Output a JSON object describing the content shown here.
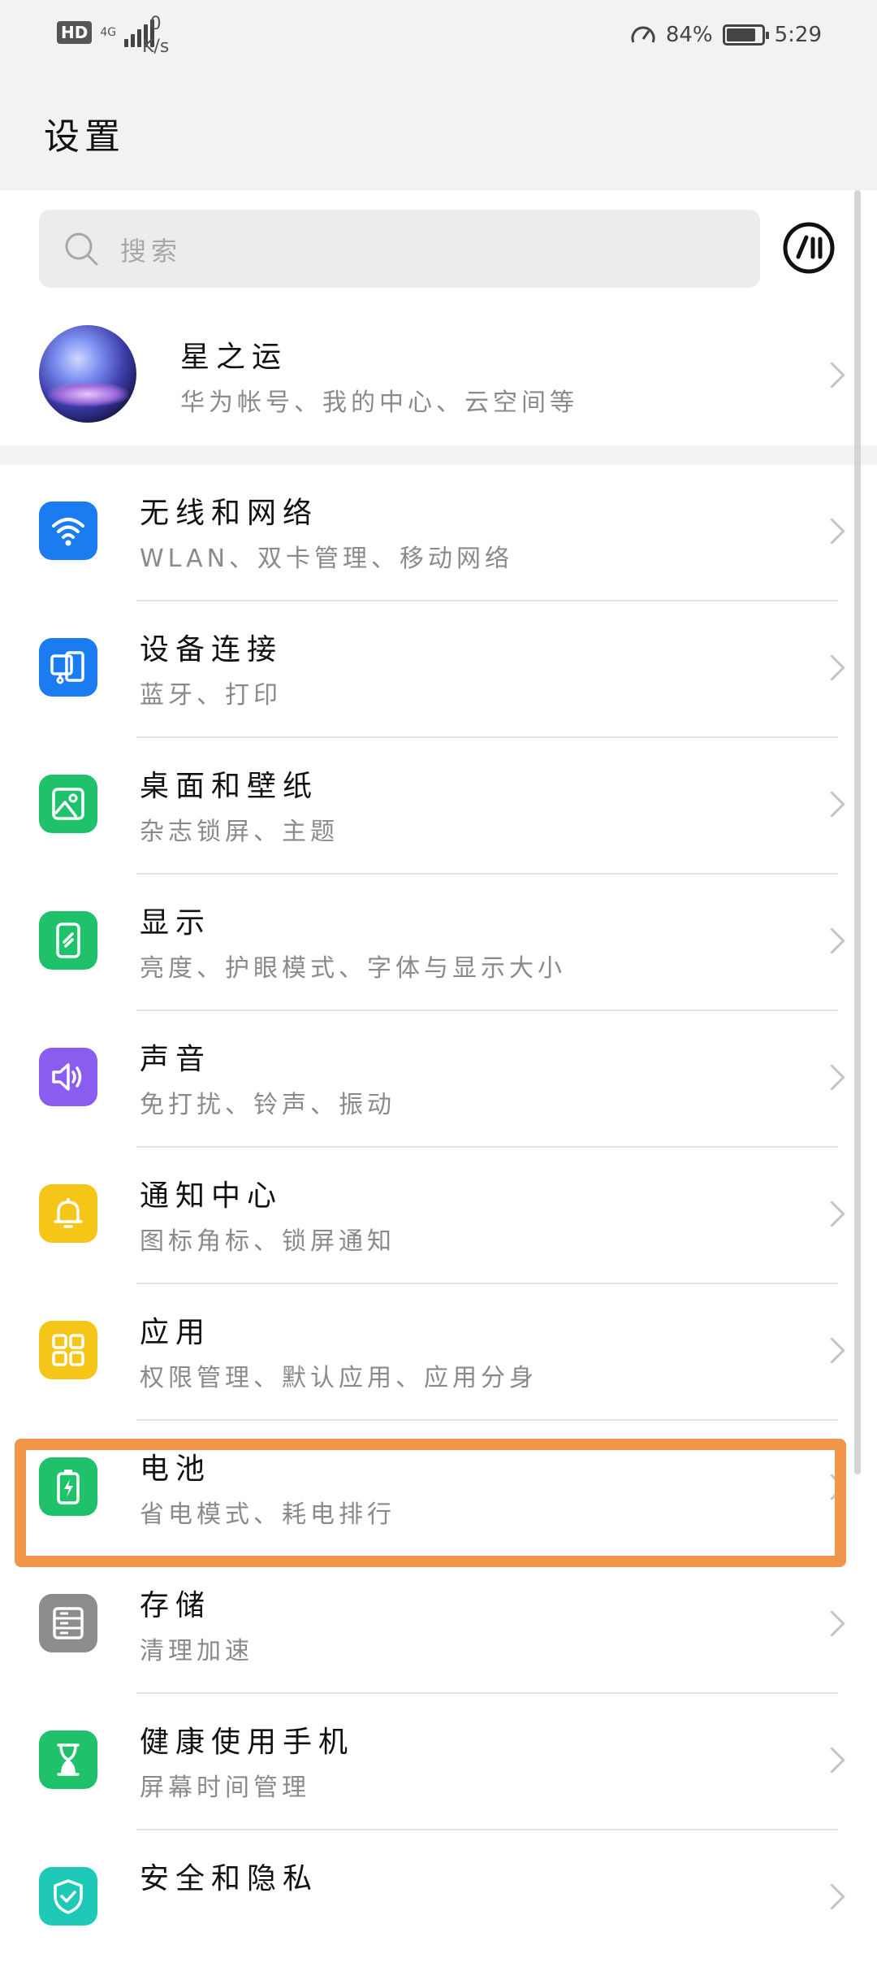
{
  "status_bar": {
    "hd": "HD",
    "network": "4G",
    "speed_value": "0",
    "speed_unit": "K/s",
    "battery_percent": "84%",
    "battery_level": 0.84,
    "time": "5:29"
  },
  "header": {
    "title": "设置"
  },
  "search": {
    "placeholder": "搜索"
  },
  "account": {
    "name": "星之运",
    "subtitle": "华为帐号、我的中心、云空间等"
  },
  "settings": [
    {
      "title": "无线和网络",
      "subtitle": "WLAN、双卡管理、移动网络",
      "icon": "wifi-icon",
      "color": "#1a7cf0"
    },
    {
      "title": "设备连接",
      "subtitle": "蓝牙、打印",
      "icon": "device-connection-icon",
      "color": "#1a7cf0"
    },
    {
      "title": "桌面和壁纸",
      "subtitle": "杂志锁屏、主题",
      "icon": "wallpaper-icon",
      "color": "#1fc26b"
    },
    {
      "title": "显示",
      "subtitle": "亮度、护眼模式、字体与显示大小",
      "icon": "display-icon",
      "color": "#1fc26b"
    },
    {
      "title": "声音",
      "subtitle": "免打扰、铃声、振动",
      "icon": "sound-icon",
      "color": "#8a5cf0"
    },
    {
      "title": "通知中心",
      "subtitle": "图标角标、锁屏通知",
      "icon": "bell-icon",
      "color": "#f5c518"
    },
    {
      "title": "应用",
      "subtitle": "权限管理、默认应用、应用分身",
      "icon": "apps-icon",
      "color": "#f5c518"
    },
    {
      "title": "电池",
      "subtitle": "省电模式、耗电排行",
      "icon": "battery-icon",
      "color": "#1fc26b"
    },
    {
      "title": "存储",
      "subtitle": "清理加速",
      "icon": "storage-icon",
      "color": "#8c8c8c"
    },
    {
      "title": "健康使用手机",
      "subtitle": "屏幕时间管理",
      "icon": "hourglass-icon",
      "color": "#1fc26b"
    },
    {
      "title": "安全和隐私",
      "subtitle": "",
      "icon": "shield-icon",
      "color": "#1ec9b8"
    }
  ],
  "highlight": {
    "color": "#f0954a",
    "target": "电池"
  }
}
